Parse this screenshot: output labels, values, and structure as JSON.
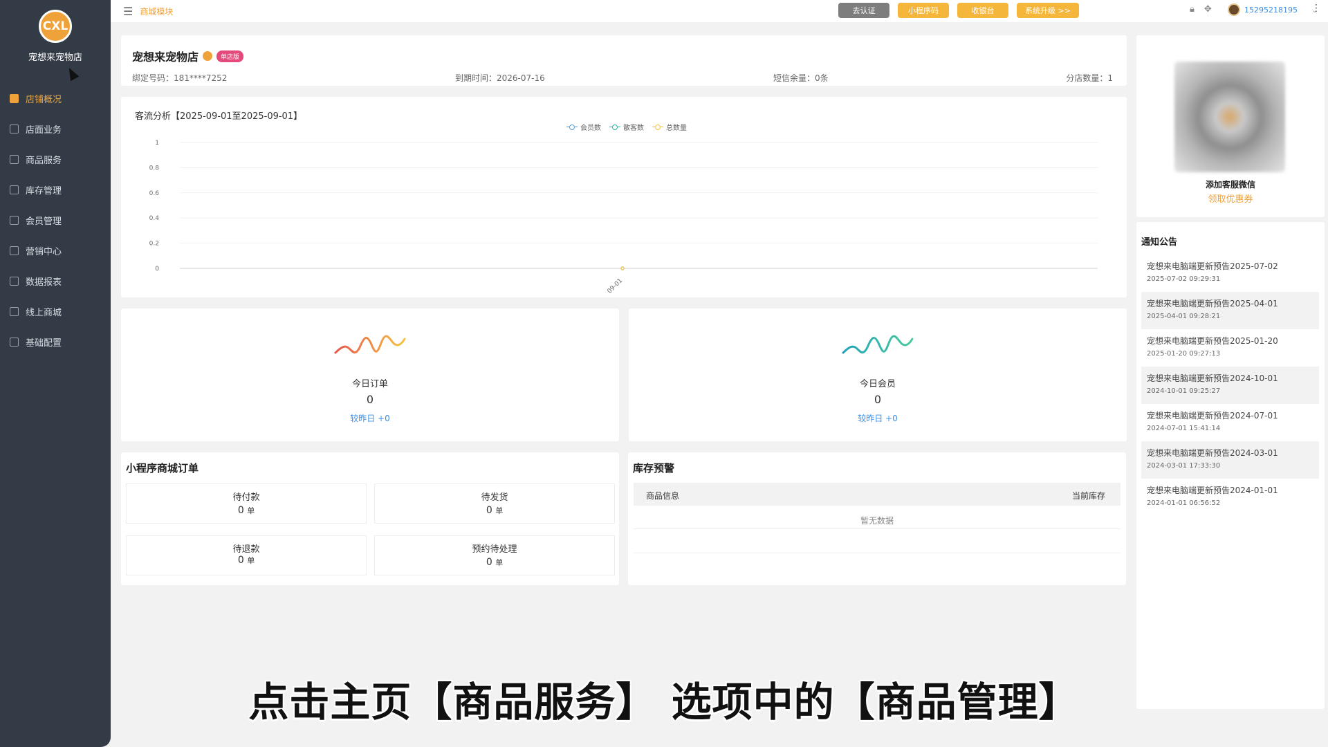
{
  "brand": {
    "logo_text": "CXL",
    "shop_name": "宠想来宠物店"
  },
  "sidebar": {
    "items": [
      {
        "label": "店铺概况",
        "icon": "store-icon",
        "active": true
      },
      {
        "label": "店面业务",
        "icon": "cart-icon"
      },
      {
        "label": "商品服务",
        "icon": "goods-icon"
      },
      {
        "label": "库存管理",
        "icon": "inventory-icon"
      },
      {
        "label": "会员管理",
        "icon": "member-icon"
      },
      {
        "label": "营销中心",
        "icon": "marketing-icon"
      },
      {
        "label": "数据报表",
        "icon": "report-icon"
      },
      {
        "label": "线上商城",
        "icon": "mall-icon"
      },
      {
        "label": "基础配置",
        "icon": "settings-icon"
      }
    ]
  },
  "topbar": {
    "breadcrumb": "商城模块",
    "buttons": [
      "去认证",
      "小程序码",
      "收银台",
      "系统升级 >>"
    ],
    "user": "15295218195"
  },
  "shop": {
    "name": "宠想来宠物店",
    "tag": "单店版",
    "bind_phone": "绑定号码：181****7252",
    "expire": "到期时间：2026-07-16",
    "sms": "短信余量：0条",
    "branches": "分店数量：1"
  },
  "traffic": {
    "title": "客流分析【2025-09-01至2025-09-01】",
    "legend": [
      "会员数",
      "散客数",
      "总数量"
    ]
  },
  "chart_data": {
    "type": "line",
    "title": "客流分析【2025-09-01至2025-09-01】",
    "x": [
      "09-01"
    ],
    "series": [
      {
        "name": "会员数",
        "values": [
          0
        ],
        "color": "#5b9bd5"
      },
      {
        "name": "散客数",
        "values": [
          0
        ],
        "color": "#2fb5a5"
      },
      {
        "name": "总数量",
        "values": [
          0
        ],
        "color": "#f5c242"
      }
    ],
    "yticks": [
      "1",
      "0.8",
      "0.6",
      "0.4",
      "0.2",
      "0"
    ],
    "ylim": [
      0,
      1
    ]
  },
  "stats": {
    "orders": {
      "label": "今日订单",
      "value": "0",
      "compare": "较昨日 +0"
    },
    "members": {
      "label": "今日会员",
      "value": "0",
      "compare": "较昨日 +0"
    }
  },
  "mini_orders": {
    "title": "小程序商城订单",
    "items": [
      {
        "label": "待付款",
        "value": "0",
        "unit": "单"
      },
      {
        "label": "待发货",
        "value": "0",
        "unit": "单"
      },
      {
        "label": "待退款",
        "value": "0",
        "unit": "单"
      },
      {
        "label": "预约待处理",
        "value": "0",
        "unit": "单"
      }
    ]
  },
  "stock": {
    "title": "库存预警",
    "col_product": "商品信息",
    "col_stock": "当前库存",
    "empty": "暂无数据"
  },
  "service": {
    "name": "添加客服微信",
    "coupon": "领取优惠券"
  },
  "notices": {
    "title": "通知公告",
    "items": [
      {
        "title": "宠想来电脑端更新预告2025-07-02",
        "date": "2025-07-02 09:29:31"
      },
      {
        "title": "宠想来电脑端更新预告2025-04-01",
        "date": "2025-04-01 09:28:21"
      },
      {
        "title": "宠想来电脑端更新预告2025-01-20",
        "date": "2025-01-20 09:27:13"
      },
      {
        "title": "宠想来电脑端更新预告2024-10-01",
        "date": "2024-10-01 09:25:27"
      },
      {
        "title": "宠想来电脑端更新预告2024-07-01",
        "date": "2024-07-01 15:41:14"
      },
      {
        "title": "宠想来电脑端更新预告2024-03-01",
        "date": "2024-03-01 17:33:30"
      },
      {
        "title": "宠想来电脑端更新预告2024-01-01",
        "date": "2024-01-01 06:56:52"
      }
    ]
  },
  "caption": "点击主页【商品服务】 选项中的【商品管理】"
}
